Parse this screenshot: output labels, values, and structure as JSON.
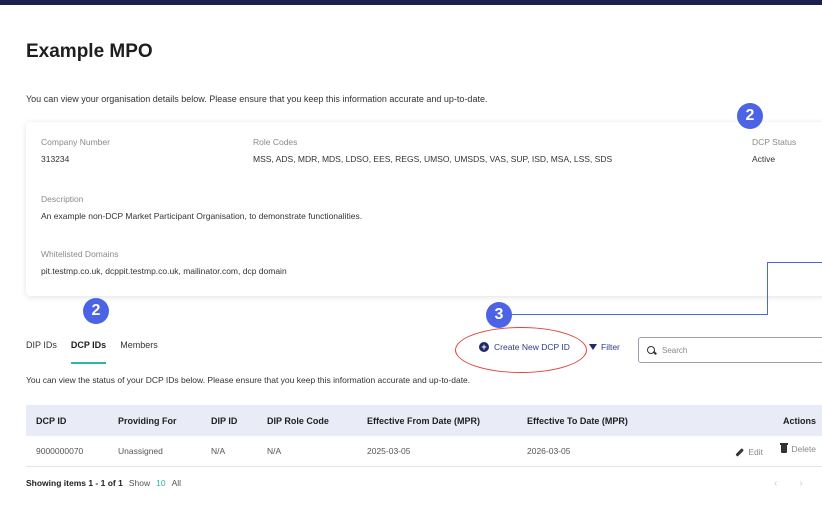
{
  "page": {
    "title": "Example MPO",
    "intro": "You can view your organisation details below. Please ensure that you keep this information accurate and up-to-date."
  },
  "details": {
    "company_number_label": "Company Number",
    "company_number": "313234",
    "role_codes_label": "Role Codes",
    "role_codes": "MSS, ADS, MDR, MDS, LDSO, EES, REGS, UMSO, UMSDS, VAS, SUP, ISD, MSA, LSS, SDS",
    "dcp_status_label": "DCP Status",
    "dcp_status": "Active",
    "description_label": "Description",
    "description": "An example non-DCP Market Participant Organisation, to demonstrate functionalities.",
    "domains_label": "Whitelisted Domains",
    "domains": "pit.testmp.co.uk, dcppit.testmp.co.uk, mailinator.com, dcp domain"
  },
  "annotations": {
    "badge_status": "2",
    "badge_tabs": "2",
    "badge_create": "3"
  },
  "tabs": [
    {
      "label": "DIP IDs"
    },
    {
      "label": "DCP IDs"
    },
    {
      "label": "Members"
    }
  ],
  "toolbar": {
    "create_label": "Create New DCP ID",
    "filter_label": "Filter",
    "search_placeholder": "Search"
  },
  "table_description": "You can view the status of your DCP IDs below. Please ensure that you keep this information accurate and up-to-date.",
  "table": {
    "headers": [
      "DCP ID",
      "Providing For",
      "DIP ID",
      "DIP Role Code",
      "Effective From Date (MPR)",
      "Effective To Date (MPR)",
      "Actions"
    ],
    "rows": [
      {
        "dcp_id": "9000000070",
        "providing_for": "Unassigned",
        "dip_id": "N/A",
        "dip_role_code": "N/A",
        "from": "2025-03-05",
        "to": "2026-03-05",
        "edit": "Edit",
        "delete": "Delete"
      }
    ]
  },
  "footer": {
    "showing": "Showing items 1 - 1 of 1",
    "show_label": "Show",
    "show_selected": "10",
    "show_all": "All",
    "prev": "‹",
    "next": "›"
  },
  "colors": {
    "accent_badge": "#4b63e4",
    "tab_underline": "#2bb6a8",
    "annotation_ring": "#e0443e",
    "header_bar": "#1d1f4e"
  }
}
